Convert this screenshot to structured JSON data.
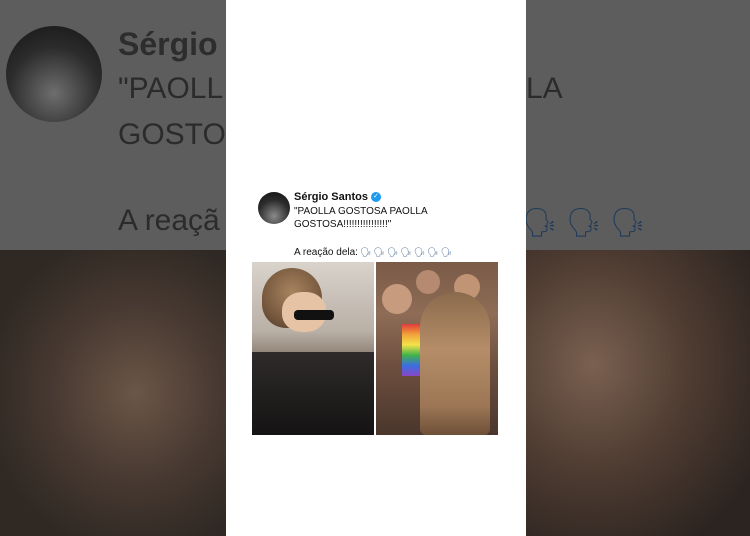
{
  "background": {
    "name": "Sérgio",
    "line1_left": "\"PAOLL",
    "line1_right": "LA",
    "line2": "GOSTO",
    "line3": "A reaçã",
    "emoji_glyph": "🗣"
  },
  "tweet": {
    "author": "Sérgio Santos",
    "verified": true,
    "text": "\"PAOLLA GOSTOSA PAOLLA GOSTOSA!!!!!!!!!!!!!!!!\"",
    "reaction_label": "A reação dela:",
    "reaction_emoji": [
      "🗣",
      "🗣",
      "🗣",
      "🗣",
      "🗣",
      "🗣",
      "🗣"
    ]
  },
  "colors": {
    "verified": "#1d9bf0",
    "text": "#111111",
    "center_bg": "#ffffff"
  }
}
